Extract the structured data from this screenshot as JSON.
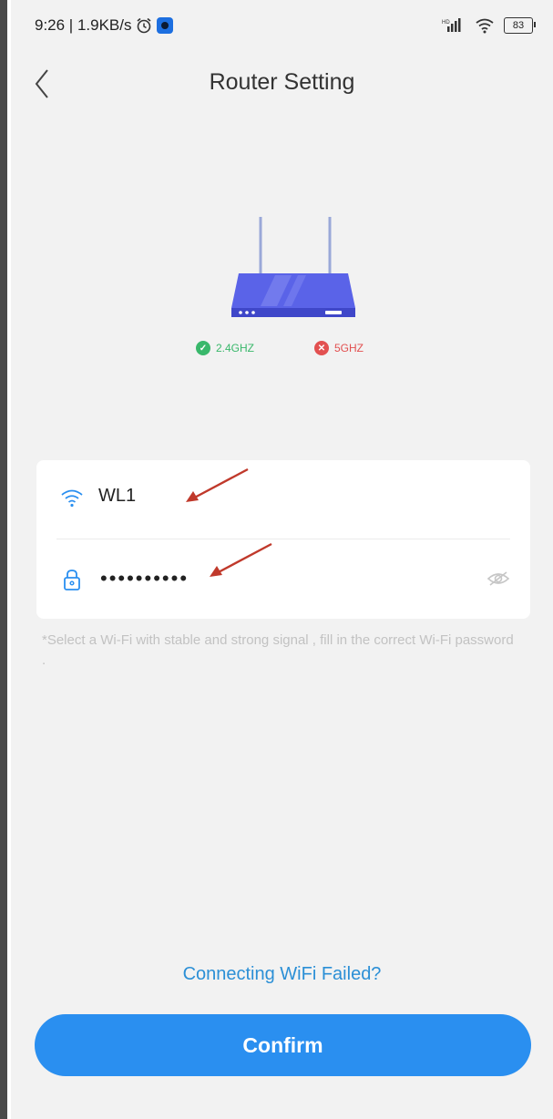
{
  "status_bar": {
    "time_speed": "9:26 | 1.9KB/s",
    "signal": "HD",
    "battery": "83"
  },
  "header": {
    "title": "Router Setting",
    "back_icon": "chevron-left-icon"
  },
  "router": {
    "bands": [
      {
        "label": "2.4GHZ",
        "status": "ok",
        "color": "#39b86b"
      },
      {
        "label": "5GHZ",
        "status": "fail",
        "color": "#e25050"
      }
    ]
  },
  "form": {
    "ssid": {
      "icon": "wifi-icon",
      "value": "WL1"
    },
    "password": {
      "icon": "lock-icon",
      "value": "••••••••••",
      "toggle_icon": "eye-icon"
    }
  },
  "hint": "*Select a Wi-Fi with stable and strong signal , fill in the correct Wi-Fi password .",
  "help_link": "Connecting WiFi Failed?",
  "confirm_label": "Confirm",
  "colors": {
    "accent": "#2a8ff0",
    "link": "#2b8fd6",
    "background": "#f2f2f2",
    "annotation_arrow": "#c0392b"
  }
}
